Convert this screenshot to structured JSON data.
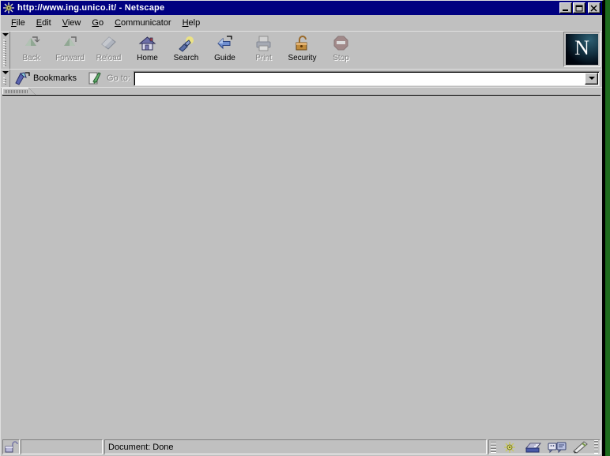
{
  "window": {
    "title": "http://www.ing.unico.it/ - Netscape",
    "title_icon": "netscape-starburst-icon",
    "minimize_label": "Minimize",
    "maximize_label": "Maximize",
    "close_label": "Close",
    "colors": {
      "titlebar_active": "#000080",
      "face": "#c0c0c0",
      "desktop": "#1d6b1d",
      "content_bg": "#c0c0c0"
    }
  },
  "menubar": {
    "items": [
      {
        "label": "File",
        "accel": "F"
      },
      {
        "label": "Edit",
        "accel": "E"
      },
      {
        "label": "View",
        "accel": "V"
      },
      {
        "label": "Go",
        "accel": "G"
      },
      {
        "label": "Communicator",
        "accel": "C"
      },
      {
        "label": "Help",
        "accel": "H"
      }
    ]
  },
  "toolbar": {
    "buttons": [
      {
        "label": "Back",
        "icon": "back-arrow-icon",
        "enabled": false
      },
      {
        "label": "Forward",
        "icon": "forward-arrow-icon",
        "enabled": false
      },
      {
        "label": "Reload",
        "icon": "reload-icon",
        "enabled": false
      },
      {
        "label": "Home",
        "icon": "house-icon",
        "enabled": true
      },
      {
        "label": "Search",
        "icon": "flashlight-icon",
        "enabled": true
      },
      {
        "label": "Guide",
        "icon": "guide-arrow-icon",
        "enabled": true
      },
      {
        "label": "Print",
        "icon": "printer-icon",
        "enabled": false
      },
      {
        "label": "Security",
        "icon": "padlock-icon",
        "enabled": true
      },
      {
        "label": "Stop",
        "icon": "stop-sign-icon",
        "enabled": false
      }
    ],
    "logo": {
      "letter": "N",
      "name": "netscape-logo-button"
    }
  },
  "locationbar": {
    "bookmarks_label": "Bookmarks",
    "bookmarks_icon": "bookmark-ribbon-icon",
    "page_icon": "page-quill-icon",
    "goto_label": "Go to:",
    "url_value": "",
    "url_placeholder": "",
    "dropdown_icon": "chevron-down-icon"
  },
  "statusbar": {
    "security_icon": "unlocked-padlock-icon",
    "progress_value": "",
    "message": "Document: Done",
    "component_bar": [
      {
        "label": "Navigator",
        "icon": "navigator-starburst-icon"
      },
      {
        "label": "Mailbox",
        "icon": "mailbox-inbox-icon"
      },
      {
        "label": "Discussions",
        "icon": "discussion-bubbles-icon"
      },
      {
        "label": "Composer",
        "icon": "composer-pencil-icon"
      }
    ]
  }
}
